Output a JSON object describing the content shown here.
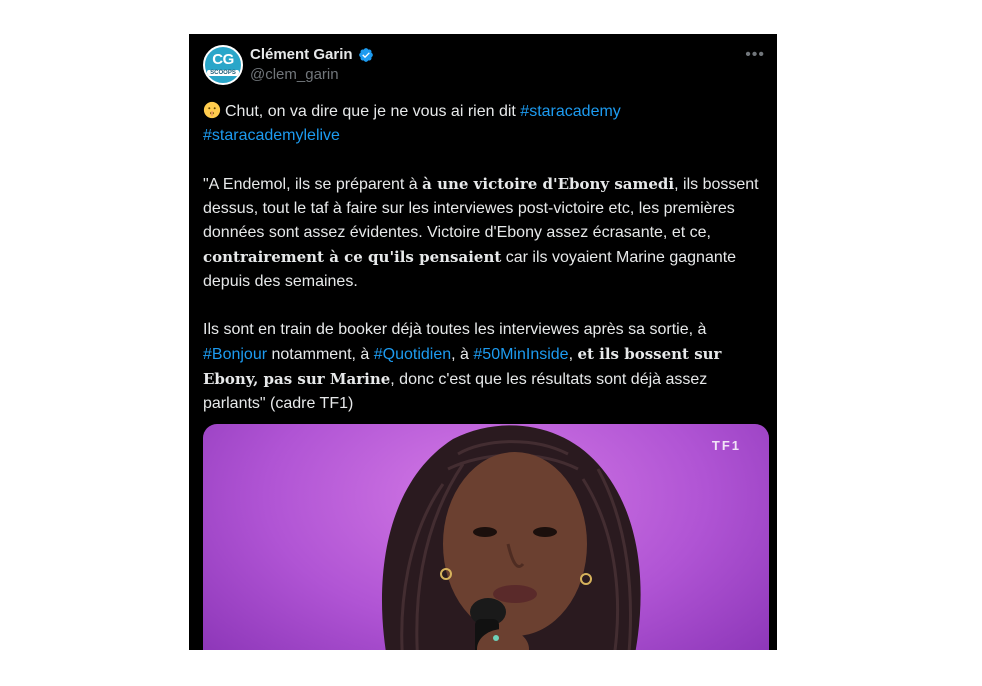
{
  "author": {
    "name": "Clément Garin",
    "handle": "@clem_garin",
    "avatar_text": "CG",
    "avatar_sub": "SCOOPS"
  },
  "tweet": {
    "line1_text": "Chut, on va dire que je ne vous ai rien dit ",
    "tag1": "#staracademy",
    "tag2": "#staracademylelive",
    "p2_a": "\"A Endemol, ils se préparent à ",
    "p2_b": "à une victoire d'Ebony samedi",
    "p2_c": ", ils bossent dessus, tout le taf à faire sur les interviewes post-victoire etc, les premières données sont assez évidentes. Victoire d'Ebony assez écrasante, et ce, ",
    "p2_d": "contrairement à ce qu'ils pensaient",
    "p2_e": " car ils voyaient Marine gagnante depuis des semaines.",
    "p3_a": "Ils sont en train de booker déjà toutes les interviewes après sa sortie, à ",
    "tag3": "#Bonjour",
    "p3_b": " notamment, à ",
    "tag4": "#Quotidien",
    "p3_c": ", à ",
    "tag5": "#50MinInside",
    "p3_d": ", ",
    "p3_e": "et ils bossent sur Ebony, pas sur Marine",
    "p3_f": ", donc c'est que les résultats sont déjà assez parlants\" (cadre TF1)"
  },
  "media": {
    "watermark": "TF1"
  },
  "colors": {
    "background": "#000000",
    "text": "#e7e9ea",
    "link": "#1d9bf0",
    "muted": "#71767b",
    "verified": "#1d9bf0"
  },
  "icons": {
    "verified": "verified-badge-icon",
    "more": "more-options-icon",
    "emoji": "shushing-face-icon"
  }
}
